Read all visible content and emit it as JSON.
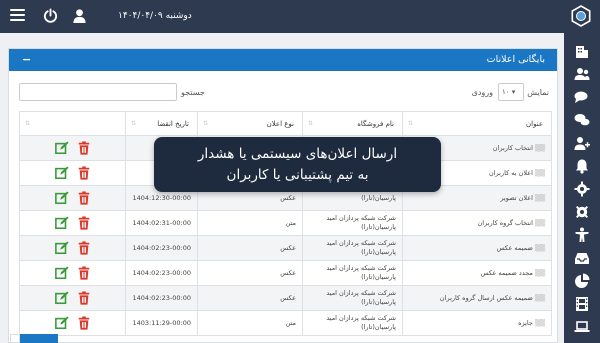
{
  "topbar": {
    "date": "دوشنبه ۱۴۰۴/۰۴/۰۹",
    "menu_icon": "hamburger-icon",
    "power_icon": "power-icon",
    "user_icon": "user-icon"
  },
  "sidebar": {
    "icons": [
      "building-icon",
      "users-icon",
      "comments-icon",
      "comment-icon",
      "user-plus-icon",
      "bell-icon",
      "gear-icon",
      "settings-icon",
      "accessibility-icon",
      "tray-icon",
      "pie-chart-icon",
      "film-icon",
      "laptop-icon"
    ]
  },
  "panel": {
    "title": "بایگانی اعلانات",
    "collapse": "−"
  },
  "controls": {
    "search_label": "جستجو",
    "show_label": "نمایش",
    "show_value": "۱۰",
    "entries_label": "ورودی"
  },
  "table": {
    "headers": {
      "title": "عنوان",
      "store": "نام فروشگاه",
      "type": "نوع اعلان",
      "expiry": "تاریخ انقضا"
    },
    "rows": [
      {
        "title": "انتخاب کاربران",
        "store": "",
        "type": "",
        "expiry": ""
      },
      {
        "title": "اعلان به کاربران",
        "store": "",
        "type": "",
        "expiry": ""
      },
      {
        "title": "اعلان تصویر",
        "store": "پارسیان(تارا)",
        "type": "عکس",
        "expiry": "1404:12:30-00:00"
      },
      {
        "title": "انتخاب گروه کاربران",
        "store": "شرکت شبکه پردازان امید پارسیان(تارا)",
        "type": "متن",
        "expiry": "1404:02:31-00:00"
      },
      {
        "title": "ضمیمه عکس",
        "store": "شرکت شبکه پردازان امید پارسیان(تارا)",
        "type": "عکس",
        "expiry": "1404:02:23-00:00"
      },
      {
        "title": "مجدد ضمیمه عکس",
        "store": "شرکت شبکه پردازان امید پارسیان(تارا)",
        "type": "عکس",
        "expiry": "1404:02:23-00:00"
      },
      {
        "title": "ضمیمه عکس ارسال گروه کاربران",
        "store": "شرکت شبکه پردازان امید پارسیان(تارا)",
        "type": "عکس",
        "expiry": "1404:02:23-00:00"
      },
      {
        "title": "جایزه",
        "store": "شرکت شبکه پردازان امید پارسیان(تارا)",
        "type": "متن",
        "expiry": "1403:11:29-00:00"
      }
    ]
  },
  "tooltip": {
    "line1": "ارسال اعلان‌های سیستمی یا هشدار",
    "line2": "به تیم پشتیبانی یا کاربران"
  },
  "colors": {
    "topbar": "#2d3a4f",
    "primary": "#1b77c4",
    "edit": "#3a9a3a",
    "delete": "#d93a2b"
  }
}
